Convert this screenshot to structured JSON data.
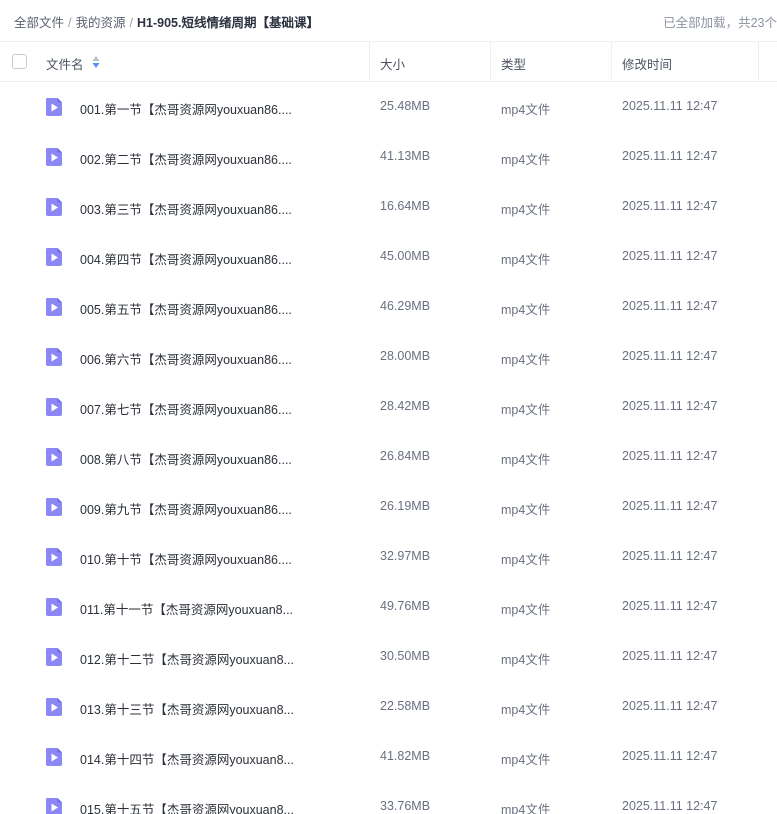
{
  "breadcrumb": {
    "items": [
      "全部文件",
      "我的资源"
    ],
    "separator": "/",
    "current": "H1-905.短线情绪周期【基础课】"
  },
  "status": {
    "loaded_text": "已全部加载，共23个"
  },
  "table": {
    "columns": {
      "name": "文件名",
      "size": "大小",
      "type": "类型",
      "modified": "修改时间"
    },
    "rows": [
      {
        "name": "001.第一节【杰哥资源网youxuan86....",
        "size": "25.48MB",
        "type": "mp4文件",
        "modified": "2025.11.11 12:47"
      },
      {
        "name": "002.第二节【杰哥资源网youxuan86....",
        "size": "41.13MB",
        "type": "mp4文件",
        "modified": "2025.11.11 12:47"
      },
      {
        "name": "003.第三节【杰哥资源网youxuan86....",
        "size": "16.64MB",
        "type": "mp4文件",
        "modified": "2025.11.11 12:47"
      },
      {
        "name": "004.第四节【杰哥资源网youxuan86....",
        "size": "45.00MB",
        "type": "mp4文件",
        "modified": "2025.11.11 12:47"
      },
      {
        "name": "005.第五节【杰哥资源网youxuan86....",
        "size": "46.29MB",
        "type": "mp4文件",
        "modified": "2025.11.11 12:47"
      },
      {
        "name": "006.第六节【杰哥资源网youxuan86....",
        "size": "28.00MB",
        "type": "mp4文件",
        "modified": "2025.11.11 12:47"
      },
      {
        "name": "007.第七节【杰哥资源网youxuan86....",
        "size": "28.42MB",
        "type": "mp4文件",
        "modified": "2025.11.11 12:47"
      },
      {
        "name": "008.第八节【杰哥资源网youxuan86....",
        "size": "26.84MB",
        "type": "mp4文件",
        "modified": "2025.11.11 12:47"
      },
      {
        "name": "009.第九节【杰哥资源网youxuan86....",
        "size": "26.19MB",
        "type": "mp4文件",
        "modified": "2025.11.11 12:47"
      },
      {
        "name": "010.第十节【杰哥资源网youxuan86....",
        "size": "32.97MB",
        "type": "mp4文件",
        "modified": "2025.11.11 12:47"
      },
      {
        "name": "011.第十一节【杰哥资源网youxuan8...",
        "size": "49.76MB",
        "type": "mp4文件",
        "modified": "2025.11.11 12:47"
      },
      {
        "name": "012.第十二节【杰哥资源网youxuan8...",
        "size": "30.50MB",
        "type": "mp4文件",
        "modified": "2025.11.11 12:47"
      },
      {
        "name": "013.第十三节【杰哥资源网youxuan8...",
        "size": "22.58MB",
        "type": "mp4文件",
        "modified": "2025.11.11 12:47"
      },
      {
        "name": "014.第十四节【杰哥资源网youxuan8...",
        "size": "41.82MB",
        "type": "mp4文件",
        "modified": "2025.11.11 12:47"
      },
      {
        "name": "015.第十五节【杰哥资源网youxuan8...",
        "size": "33.76MB",
        "type": "mp4文件",
        "modified": "2025.11.11 12:47"
      }
    ]
  },
  "icons": {
    "file": "video-file-icon",
    "sort": "sort-toggle-icon"
  },
  "colors": {
    "video_icon": "#8b87f5",
    "video_icon_dark": "#6f69e8",
    "sort_active": "#4f8ef7"
  }
}
